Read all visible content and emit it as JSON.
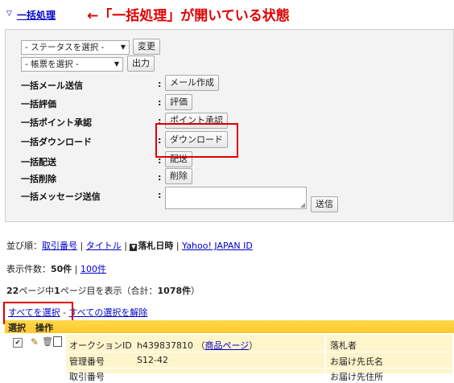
{
  "header": {
    "toggle_icon": "triangle-down-icon",
    "link": "一括処理",
    "annotation": "←「一括処理」が開いている状態"
  },
  "panel": {
    "status_select": "- ステータスを選択 -",
    "change_button": "変更",
    "form_select": "- 帳票を選択 -",
    "output_button": "出力",
    "rows": [
      {
        "label": "一括メール送信",
        "button": "メール作成"
      },
      {
        "label": "一括評価",
        "button": "評価"
      },
      {
        "label": "一括ポイント承認",
        "button": "ポイント承認"
      },
      {
        "label": "一括ダウンロード",
        "button": "ダウンロード"
      },
      {
        "label": "一括配送",
        "button": "配送"
      },
      {
        "label": "一括削除",
        "button": "削除"
      },
      {
        "label": "一括メッセージ送信",
        "button": "送信"
      }
    ],
    "colon": ":"
  },
  "sort": {
    "prefix": "並び順：",
    "opt1": "取引番号",
    "sep": " | ",
    "opt2": "タイトル",
    "opt3": "落札日時",
    "opt4": "Yahoo! JAPAN ID"
  },
  "display": {
    "prefix": "表示件数：",
    "current": "50件",
    "sep": " | ",
    "other": "100件"
  },
  "page_info": {
    "pages": "22",
    "text1": "ページ中",
    "page": "1",
    "text2": "ページ目を表示（合計：",
    "total": "1078件",
    "text3": "）"
  },
  "selection": {
    "select_all": "すべてを選択",
    "dash": " - ",
    "deselect_all": "すべての選択を解除"
  },
  "table": {
    "header_select": "選択",
    "header_ops": "操作",
    "row1_label": "オークションID",
    "row1_value": "h439837810",
    "row1_link": "商品ページ",
    "row1_right": "落札者",
    "row2_label": "管理番号",
    "row2_value": "S12-42",
    "row2_right": "お届け先氏名",
    "row3_label": "取引番号",
    "row3_right": "お届け先住所"
  },
  "colors": {
    "annotation": "#e00000",
    "panel_bg": "#f3f3f3",
    "table_header": "#ffcc33",
    "row_bg": "#fff5cc"
  }
}
